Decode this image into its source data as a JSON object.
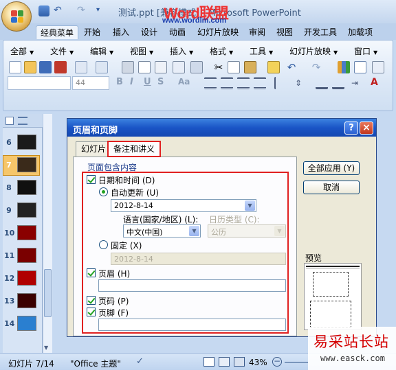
{
  "titlebar": {
    "title": "测试.ppt [兼容模式] - Microsoft PowerPoint",
    "watermark_word": "Word",
    "watermark_cn": "联盟",
    "watermark_url": "www.wordlm.com"
  },
  "ribbon_tabs": [
    "经典菜单",
    "开始",
    "插入",
    "设计",
    "动画",
    "幻灯片放映",
    "审阅",
    "视图",
    "开发工具",
    "加载项"
  ],
  "classic_menus": [
    "全部",
    "文件",
    "编辑",
    "视图",
    "插入",
    "格式",
    "工具",
    "幻灯片放映",
    "窗口"
  ],
  "font_size_value": "44",
  "slides": [
    {
      "num": "6",
      "thumb": "#1a1a1a"
    },
    {
      "num": "7",
      "thumb": "#3a2a1a"
    },
    {
      "num": "8",
      "thumb": "#101010"
    },
    {
      "num": "9",
      "thumb": "#222222"
    },
    {
      "num": "10",
      "thumb": "#8a0000"
    },
    {
      "num": "11",
      "thumb": "#7a0000"
    },
    {
      "num": "12",
      "thumb": "#b00000"
    },
    {
      "num": "13",
      "thumb": "#3a0000"
    },
    {
      "num": "14",
      "thumb": "#2a7fd0"
    }
  ],
  "selected_slide": "7",
  "dialog": {
    "title": "页眉和页脚",
    "help": "?",
    "close": "×",
    "tab_slide": "幻灯片",
    "tab_notes": "备注和讲义",
    "group_label": "页面包含内容",
    "date_time_label": "日期和时间 (D)",
    "auto_update_label": "自动更新 (U)",
    "auto_date_value": "2012-8-14",
    "language_label": "语言(国家/地区) (L):",
    "language_value": "中文(中国)",
    "calendar_label": "日历类型 (C):",
    "calendar_value": "公历",
    "fixed_label": "固定 (X)",
    "fixed_value": "2012-8-14",
    "header_label": "页眉 (H)",
    "page_number_label": "页码 (P)",
    "footer_label": "页脚 (F)",
    "apply_all": "全部应用 (Y)",
    "cancel": "取消",
    "preview_label": "预览"
  },
  "status": {
    "slide_info": "幻灯片 7/14",
    "theme": "\"Office 主题\"",
    "zoom": "43%"
  },
  "site_watermark": {
    "cn": "易采站长站",
    "url": "www.easck.com"
  }
}
